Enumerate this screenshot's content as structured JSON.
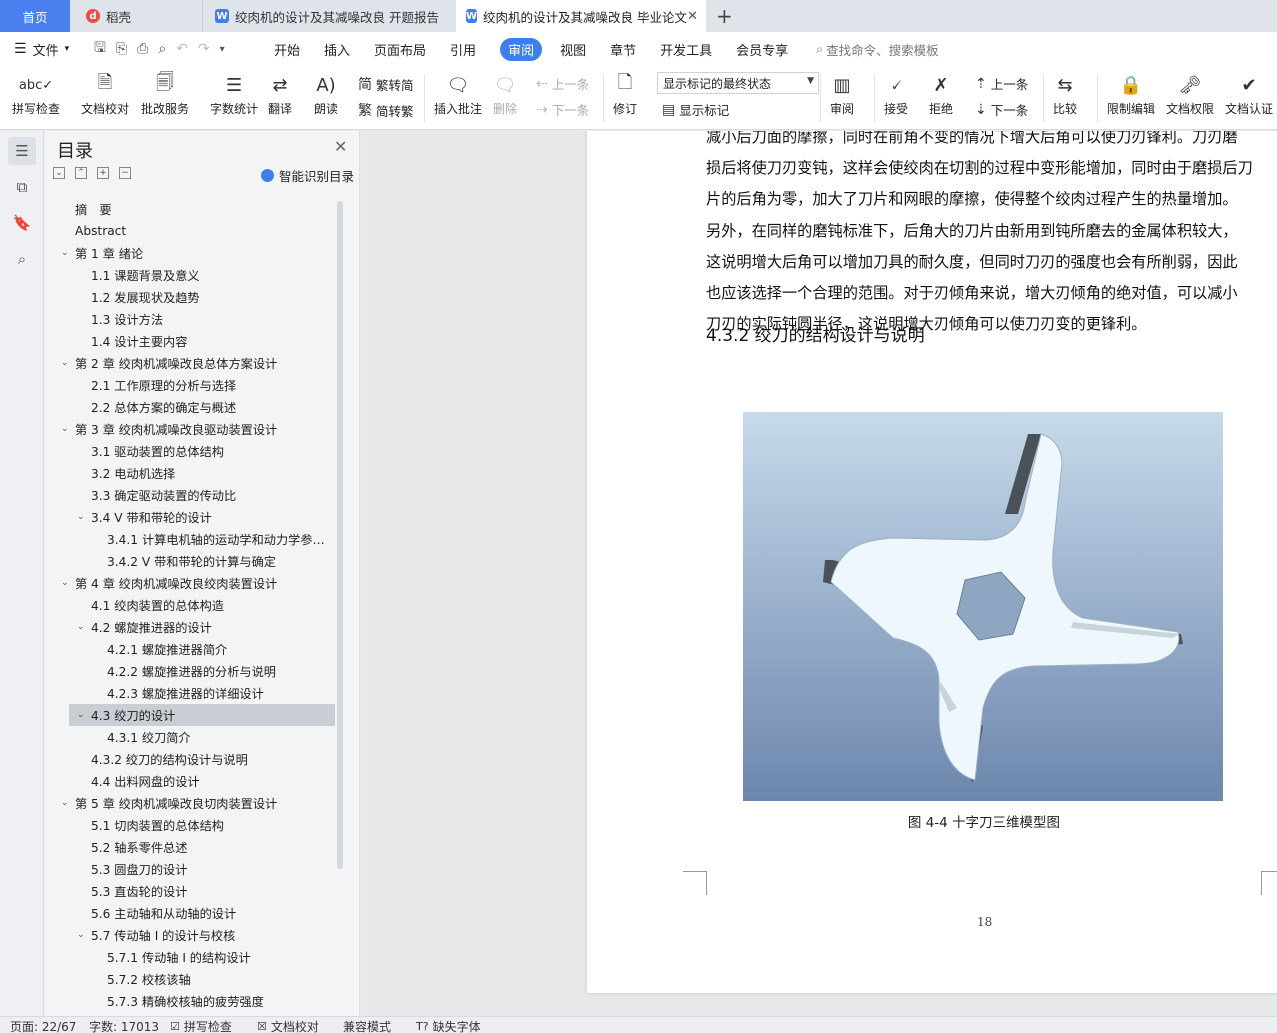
{
  "tabs": {
    "home": "首页",
    "docer": "稻壳",
    "doc1": "绞肉机的设计及其减噪改良 开题报告",
    "doc2": "绞肉机的设计及其减噪改良 毕业论文"
  },
  "menu": {
    "file": "文件",
    "items": [
      "开始",
      "插入",
      "页面布局",
      "引用",
      "审阅",
      "视图",
      "章节",
      "开发工具",
      "会员专享"
    ],
    "active": "审阅",
    "search_placeholder": "查找命令、搜索模板"
  },
  "ribbon": {
    "spell_check": "拼写检查",
    "doc_proof": "文档校对",
    "review_service": "批改服务",
    "word_count": "字数统计",
    "translate": "翻译",
    "read_aloud": "朗读",
    "to_traditional": "繁转简",
    "to_simplified": "简转繁",
    "insert_comment": "插入批注",
    "delete": "删除",
    "prev": "上一条",
    "next": "下一条",
    "track": "修订",
    "markup_select": "显示标记的最终状态",
    "show_markup": "显示标记",
    "review_pane": "审阅",
    "accept": "接受",
    "reject": "拒绝",
    "prev2": "上一条",
    "next2": "下一条",
    "compare": "比较",
    "restrict": "限制编辑",
    "permission": "文档权限",
    "certify": "文档认证"
  },
  "outline": {
    "title": "目录",
    "smart": "智能识别目录",
    "items": [
      {
        "label": "摘　要",
        "level": 0,
        "chev": false
      },
      {
        "label": "Abstract",
        "level": 0,
        "chev": false
      },
      {
        "label": "第 1 章  绪论",
        "level": 0,
        "chev": true
      },
      {
        "label": "1.1 课题背景及意义",
        "level": 1,
        "chev": false
      },
      {
        "label": "1.2 发展现状及趋势",
        "level": 1,
        "chev": false
      },
      {
        "label": "1.3 设计方法",
        "level": 1,
        "chev": false
      },
      {
        "label": "1.4 设计主要内容",
        "level": 1,
        "chev": false
      },
      {
        "label": "第 2 章  绞肉机减噪改良总体方案设计",
        "level": 0,
        "chev": true
      },
      {
        "label": "2.1  工作原理的分析与选择",
        "level": 1,
        "chev": false
      },
      {
        "label": "2.2  总体方案的确定与概述",
        "level": 1,
        "chev": false
      },
      {
        "label": "第 3 章  绞肉机减噪改良驱动装置设计",
        "level": 0,
        "chev": true
      },
      {
        "label": "3.1 驱动装置的总体结构",
        "level": 1,
        "chev": false
      },
      {
        "label": "3.2  电动机选择",
        "level": 1,
        "chev": false
      },
      {
        "label": "3.3 确定驱动装置的传动比",
        "level": 1,
        "chev": false
      },
      {
        "label": "3.4 V 带和带轮的设计",
        "level": 1,
        "chev": true
      },
      {
        "label": "3.4.1  计算电机轴的运动学和动力学参…",
        "level": 2,
        "chev": false
      },
      {
        "label": "3.4.2 V 带和带轮的计算与确定",
        "level": 2,
        "chev": false
      },
      {
        "label": "第 4 章  绞肉机减噪改良绞肉装置设计",
        "level": 0,
        "chev": true
      },
      {
        "label": "4.1 绞肉装置的总体构造",
        "level": 1,
        "chev": false
      },
      {
        "label": "4.2  螺旋推进器的设计",
        "level": 1,
        "chev": true
      },
      {
        "label": "4.2.1 螺旋推进器简介",
        "level": 2,
        "chev": false
      },
      {
        "label": "4.2.2 螺旋推进器的分析与说明",
        "level": 2,
        "chev": false
      },
      {
        "label": "4.2.3 螺旋推进器的详细设计",
        "level": 2,
        "chev": false
      },
      {
        "label": "4.3 绞刀的设计",
        "level": 1,
        "chev": true,
        "selected": true
      },
      {
        "label": "4.3.1 绞刀简介",
        "level": 2,
        "chev": false
      },
      {
        "label": "4.3.2 绞刀的结构设计与说明",
        "level": 1,
        "chev": false
      },
      {
        "label": "4.4 出料网盘的设计",
        "level": 1,
        "chev": false
      },
      {
        "label": "第 5 章  绞肉机减噪改良切肉装置设计",
        "level": 0,
        "chev": true
      },
      {
        "label": "5.1 切肉装置的总体结构",
        "level": 1,
        "chev": false
      },
      {
        "label": "5.2 轴系零件总述",
        "level": 1,
        "chev": false
      },
      {
        "label": "5.3 圆盘刀的设计",
        "level": 1,
        "chev": false
      },
      {
        "label": "5.3 直齿轮的设计",
        "level": 1,
        "chev": false
      },
      {
        "label": "5.6 主动轴和从动轴的设计",
        "level": 1,
        "chev": false
      },
      {
        "label": "5.7 传动轴 I 的设计与校核",
        "level": 1,
        "chev": true
      },
      {
        "label": "5.7.1 传动轴 I 的结构设计",
        "level": 2,
        "chev": false
      },
      {
        "label": "5.7.2 校核该轴",
        "level": 2,
        "chev": false
      },
      {
        "label": "5.7.3  精确校核轴的疲劳强度",
        "level": 2,
        "chev": false
      }
    ]
  },
  "document": {
    "lines": [
      "减小后刀面的摩擦，同时在前角不变的情况下增大后角可以使刀刃锋利。刀刃磨",
      "损后将使刀刃变钝，这样会使绞肉在切割的过程中变形能增加，同时由于磨损后刀",
      "片的后角为零，加大了刀片和网眼的摩擦，使得整个绞肉过程产生的热量增加。",
      "另外，在同样的磨钝标准下，后角大的刀片由新用到钝所磨去的金属体积较大，",
      "这说明增大后角可以增加刀具的耐久度，但同时刀刃的强度也会有所削弱，因此",
      "也应该选择一个合理的范围。对于刃倾角来说，增大刃倾角的绝对值，可以减小",
      "刀刃的实际钝圆半径，这说明增大刃倾角可以使刀刃变的更锋利。"
    ],
    "heading": "4.3.2 绞刀的结构设计与说明",
    "caption": "图 4-4  十字刀三维模型图",
    "page_number": "18"
  },
  "status": {
    "page": "页面: 22/67",
    "words": "字数: 17013",
    "spell": "拼写检查",
    "proof": "文档校对",
    "compat": "兼容模式",
    "missing_font": "缺失字体"
  }
}
